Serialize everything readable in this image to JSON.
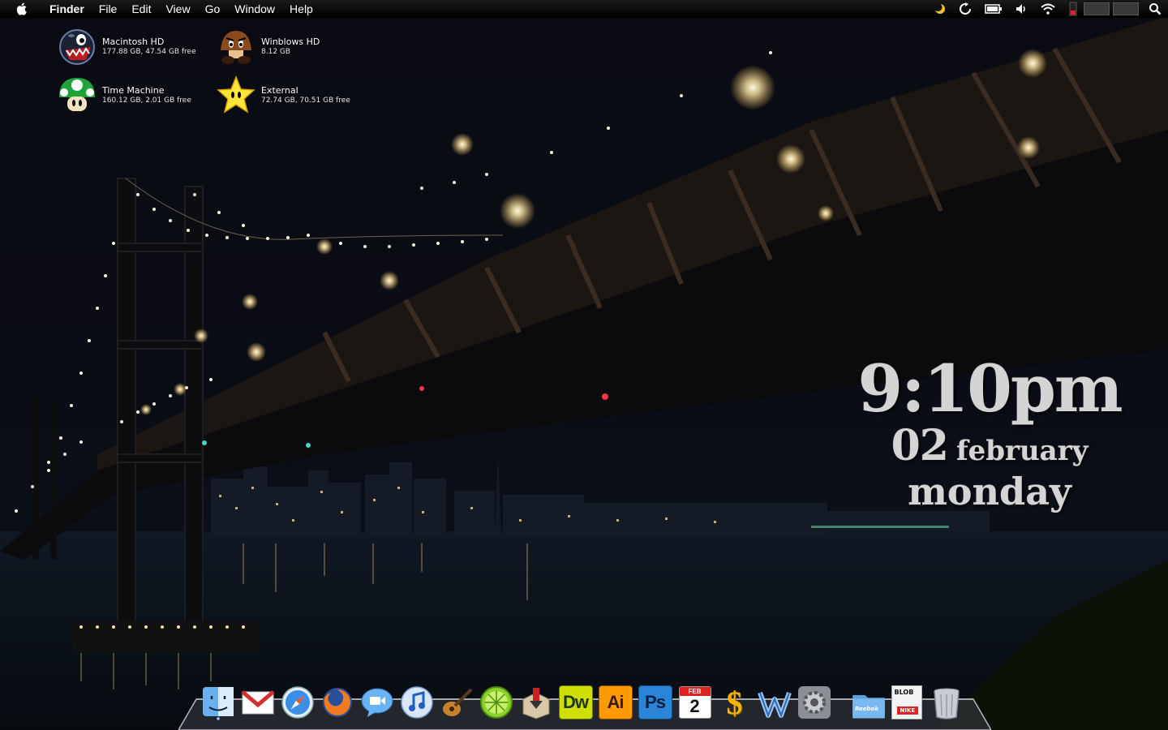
{
  "menubar": {
    "app_name": "Finder",
    "menus": [
      "File",
      "Edit",
      "View",
      "Go",
      "Window",
      "Help"
    ],
    "extras": [
      "moon-icon",
      "sync-icon",
      "battery-icon",
      "volume-icon",
      "wifi-icon",
      "spotlight-icon"
    ]
  },
  "desktop_icons": [
    {
      "name": "Macintosh HD",
      "info": "177.88 GB, 47.54 GB free",
      "icon": "chain-chomp-icon"
    },
    {
      "name": "Winblows HD",
      "info": "8.12 GB",
      "icon": "goomba-icon"
    },
    {
      "name": "Time Machine",
      "info": "160.12 GB, 2.01 GB free",
      "icon": "1up-mushroom-icon"
    },
    {
      "name": "External",
      "info": "72.74 GB, 70.51 GB free",
      "icon": "star-icon"
    }
  ],
  "clock": {
    "time": "9:10pm",
    "day": "02",
    "month": "february",
    "weekday": "monday"
  },
  "dock": {
    "apps": [
      {
        "id": "finder",
        "icon": "finder-icon"
      },
      {
        "id": "gmail",
        "icon": "gmail-icon"
      },
      {
        "id": "safari",
        "icon": "safari-icon"
      },
      {
        "id": "firefox",
        "icon": "firefox-icon"
      },
      {
        "id": "ichat",
        "icon": "ichat-icon"
      },
      {
        "id": "itunes",
        "icon": "itunes-icon"
      },
      {
        "id": "garageband",
        "icon": "garageband-icon"
      },
      {
        "id": "limewire",
        "icon": "limewire-icon"
      },
      {
        "id": "installer",
        "icon": "installer-icon"
      },
      {
        "id": "dreamweaver",
        "icon": "dreamweaver-icon",
        "label": "Dw"
      },
      {
        "id": "illustrator",
        "icon": "illustrator-icon",
        "label": "Ai"
      },
      {
        "id": "photoshop",
        "icon": "photoshop-icon",
        "label": "Ps"
      },
      {
        "id": "ical",
        "icon": "calendar-icon",
        "label": "2",
        "sub": "FEB"
      },
      {
        "id": "money",
        "icon": "dollar-icon",
        "label": "$"
      },
      {
        "id": "word",
        "icon": "word-icon"
      },
      {
        "id": "system-preferences",
        "icon": "gear-icon"
      }
    ],
    "stacks": [
      {
        "id": "reebok-folder",
        "icon": "folder-icon",
        "label": "Reebok"
      },
      {
        "id": "nike-docs",
        "icon": "document-icon",
        "label": "BLOB",
        "sub": "NIKE"
      }
    ],
    "trash": {
      "icon": "trash-icon"
    }
  },
  "colors": {
    "menubar": "#000000",
    "dreamweaver": "#cfe000",
    "illustrator": "#ff9b00",
    "photoshop": "#2a84d8",
    "clock_text": "#d4d4d4"
  }
}
